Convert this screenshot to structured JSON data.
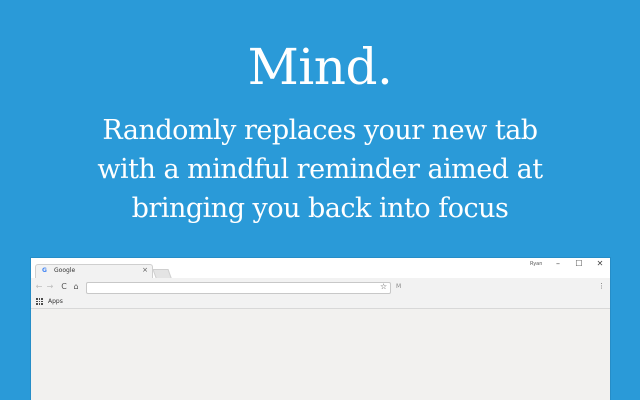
{
  "hero": {
    "title": "Mind.",
    "tagline_lines": [
      "Randomly replaces your new tab",
      "with a mindful reminder aimed at",
      "bringing you back into focus"
    ]
  },
  "browser": {
    "tab": {
      "favicon": "G",
      "title": "Google",
      "close_glyph": "×"
    },
    "profile_label": "Ryan",
    "window_controls": {
      "minimize": "–",
      "maximize": "☐",
      "close": "✕"
    },
    "toolbar": {
      "back_glyph": "←",
      "forward_glyph": "→",
      "reload_glyph": "C",
      "home_glyph": "⌂",
      "address_value": "",
      "bookmark_star_glyph": "☆",
      "extension_label": "M",
      "menu_glyph": "⋮"
    },
    "bookmarks": {
      "apps_label": "Apps"
    }
  },
  "colors": {
    "background": "#2a9ad8",
    "browser_chrome": "#f2f2f2",
    "content": "#f2f1ef"
  },
  "icons": [
    "google-favicon-icon",
    "close-tab-icon",
    "back-arrow-icon",
    "forward-arrow-icon",
    "reload-icon",
    "home-icon",
    "star-icon",
    "extension-icon",
    "menu-icon",
    "apps-grid-icon"
  ]
}
